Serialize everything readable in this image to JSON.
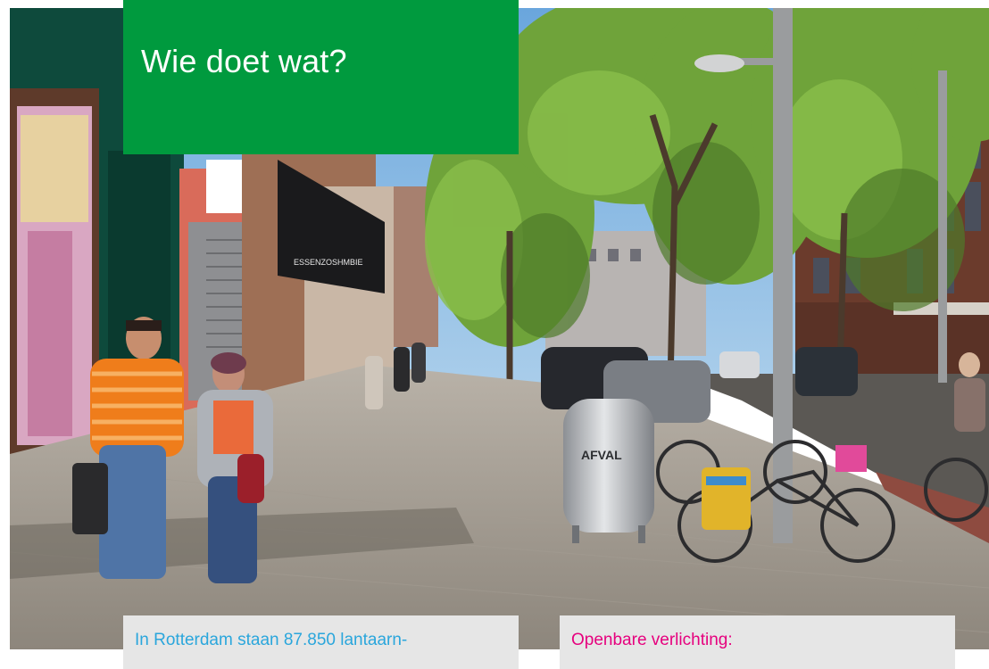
{
  "header": {
    "title": "Wie doet wat?"
  },
  "photo": {
    "bin_label": "AFVAL",
    "shop_sign": "ESSENZOSHMBIE"
  },
  "cards": {
    "left_text": "In Rotterdam staan 87.850 lantaarn-",
    "right_text": "Openbare verlichting:"
  },
  "colors": {
    "title_box": "#009a3e",
    "left_text": "#2aa6dc",
    "right_text": "#e6007e",
    "card_bg": "#e6e6e6"
  }
}
